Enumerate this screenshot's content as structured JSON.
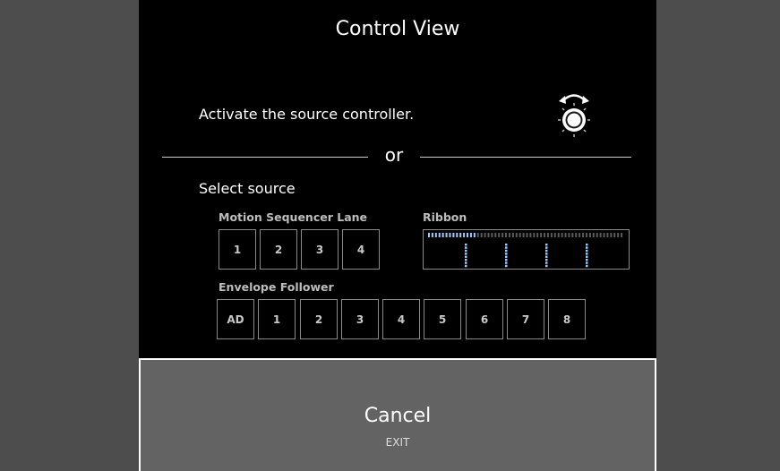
{
  "dialog": {
    "title": "Control View",
    "instruction": "Activate the source controller.",
    "knob_icon": "rotary-knob-icon",
    "or_text": "or",
    "select_label": "Select source"
  },
  "motion_sequencer": {
    "label": "Motion Sequencer Lane",
    "buttons": [
      "1",
      "2",
      "3",
      "4"
    ]
  },
  "ribbon": {
    "label": "Ribbon",
    "level": 0.25
  },
  "envelope_follower": {
    "label": "Envelope Follower",
    "buttons": [
      "AD",
      "1",
      "2",
      "3",
      "4",
      "5",
      "6",
      "7",
      "8"
    ]
  },
  "cancel": {
    "label": "Cancel",
    "sublabel": "EXIT"
  },
  "colors": {
    "background": "#4d4d4d",
    "dialog": "#000000",
    "cancel_bg": "#636363",
    "ribbon_accent": "#9ecbff"
  }
}
